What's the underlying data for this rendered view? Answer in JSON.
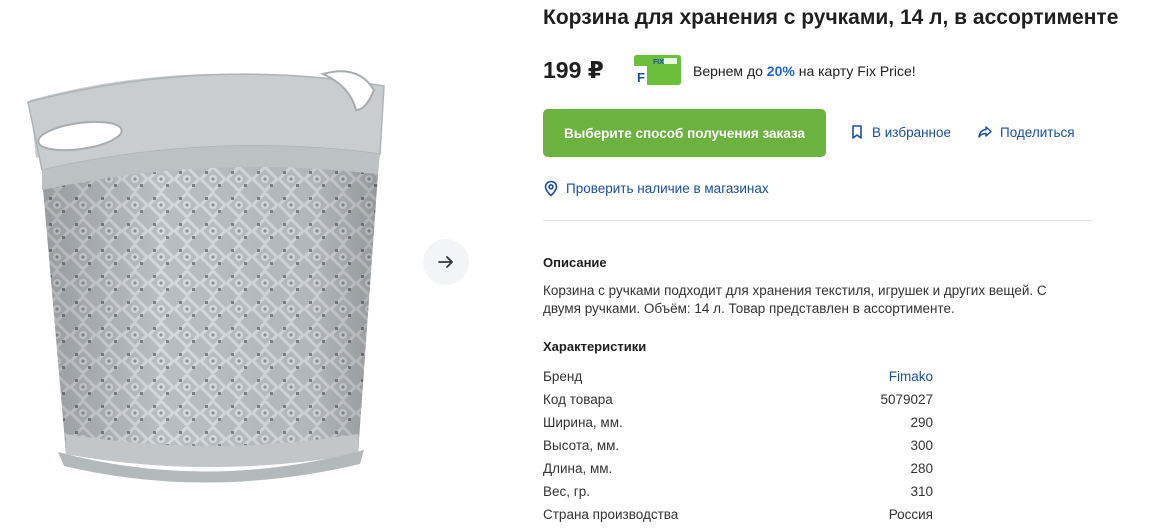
{
  "product": {
    "title": "Корзина для хранения с ручками, 14 л, в ассортименте",
    "price": "199 ₽"
  },
  "cashback": {
    "prefix": "Вернем до",
    "percent": "20%",
    "suffix": "на карту Fix Price!",
    "card_text": "FIX"
  },
  "actions": {
    "order_button": "Выберите способ получения заказа",
    "favorite": "В избранное",
    "share": "Поделиться",
    "check_stock": "Проверить наличие в магазинах"
  },
  "description": {
    "title": "Описание",
    "text": "Корзина с ручками подходит для хранения текстиля, игрушек и других вещей. С двумя ручками. Объём: 14 л. Товар представлен в ассортименте."
  },
  "specs": {
    "title": "Характеристики",
    "rows": [
      {
        "label": "Бренд",
        "value": "Fimako"
      },
      {
        "label": "Код товара",
        "value": "5079027"
      },
      {
        "label": "Ширина, мм.",
        "value": "290"
      },
      {
        "label": "Высота, мм.",
        "value": "300"
      },
      {
        "label": "Длина, мм.",
        "value": "280"
      },
      {
        "label": "Вес, гр.",
        "value": "310"
      },
      {
        "label": "Страна производства",
        "value": "Россия"
      }
    ]
  },
  "icons": {
    "next": "arrow-right-icon",
    "favorite": "bookmark-icon",
    "share": "share-icon",
    "stock": "location-pin-icon"
  },
  "colors": {
    "accent_green": "#6bb23f",
    "link_blue": "#1a4fa0",
    "cashback_blue": "#1a66d2"
  }
}
